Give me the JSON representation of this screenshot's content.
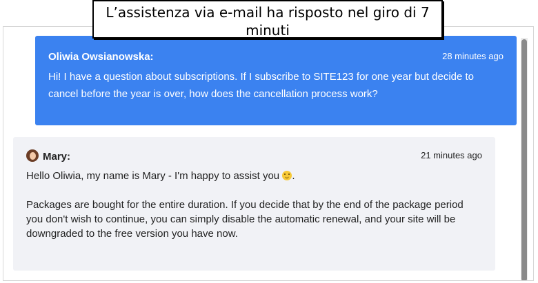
{
  "caption": "L’assistenza via e-mail ha risposto nel giro di 7 minuti",
  "colors": {
    "user_bubble": "#3b82f0",
    "agent_bubble": "#f1f2f6"
  },
  "messages": {
    "user": {
      "name": "Oliwia Owsianowska:",
      "time": "28 minutes ago",
      "text": "Hi! I have a question about subscriptions. If I subscribe to SITE123 for one year but decide to cancel before the year is over, how does the cancellation process work?"
    },
    "agent": {
      "avatar_icon": "agent-avatar",
      "name": "Mary:",
      "time": "21 minutes ago",
      "greeting": "Hello Oliwia, my name is Mary - I'm happy to assist you",
      "emoji_icon": "smiley-emoji-icon",
      "greeting_end": ".",
      "paragraph": "Packages are bought for the entire duration. If you decide that by the end of the package period you don't wish to continue, you can simply disable the automatic renewal, and your site will be downgraded to the free version you have now."
    }
  }
}
